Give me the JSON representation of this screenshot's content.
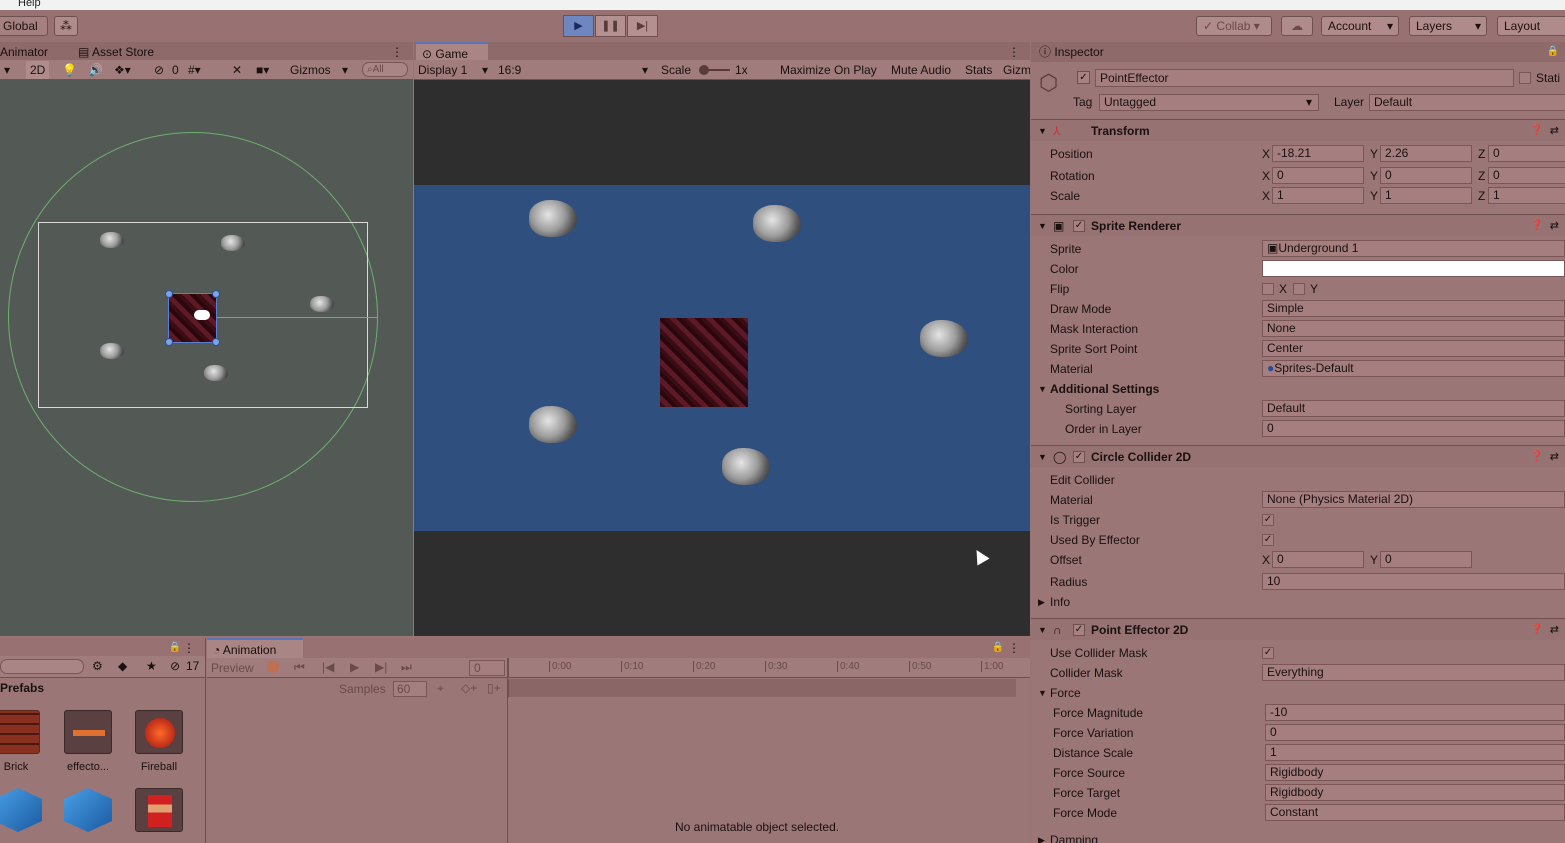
{
  "menu": {
    "item": "Help"
  },
  "toolbar": {
    "global": "Global",
    "collab": "Collab",
    "account": "Account",
    "layers": "Layers",
    "layout": "Layout",
    "play_icon": "play-icon",
    "pause_icon": "pause-icon",
    "step_icon": "step-icon"
  },
  "scene_tabs": {
    "animator": "Animator",
    "asset_store": "Asset Store"
  },
  "scene_toolbar": {
    "mode_2d": "2D",
    "hidden_count": "0",
    "gizmos": "Gizmos",
    "search_placeholder": "All"
  },
  "game": {
    "tab": "Game",
    "display": "Display 1",
    "aspect": "16:9",
    "scale_label": "Scale",
    "scale_value": "1x",
    "maximize": "Maximize On Play",
    "mute": "Mute Audio",
    "stats": "Stats",
    "gizmos": "Gizm",
    "background_color": "#2f4f7f"
  },
  "inspector": {
    "tab": "Inspector",
    "object_name": "PointEffector",
    "static": "Stati",
    "tag_label": "Tag",
    "tag_value": "Untagged",
    "layer_label": "Layer",
    "layer_value": "Default",
    "transform": {
      "title": "Transform",
      "position_label": "Position",
      "rotation_label": "Rotation",
      "scale_label": "Scale",
      "position": {
        "x": "-18.21",
        "y": "2.26",
        "z": "0"
      },
      "rotation": {
        "x": "0",
        "y": "0",
        "z": "0"
      },
      "scale": {
        "x": "1",
        "y": "1",
        "z": "1"
      },
      "axis_x": "X",
      "axis_y": "Y",
      "axis_z": "Z"
    },
    "sprite_renderer": {
      "title": "Sprite Renderer",
      "sprite_label": "Sprite",
      "sprite_value": "Underground 1",
      "color_label": "Color",
      "flip_label": "Flip",
      "flip_x": "X",
      "flip_y": "Y",
      "draw_mode_label": "Draw Mode",
      "draw_mode_value": "Simple",
      "mask_label": "Mask Interaction",
      "mask_value": "None",
      "sort_point_label": "Sprite Sort Point",
      "sort_point_value": "Center",
      "material_label": "Material",
      "material_value": "Sprites-Default",
      "additional": "Additional Settings",
      "sorting_layer_label": "Sorting Layer",
      "sorting_layer_value": "Default",
      "order_label": "Order in Layer",
      "order_value": "0"
    },
    "circle_collider": {
      "title": "Circle Collider 2D",
      "edit_collider": "Edit Collider",
      "material_label": "Material",
      "material_value": "None (Physics Material 2D)",
      "is_trigger_label": "Is Trigger",
      "used_by_effector_label": "Used By Effector",
      "offset_label": "Offset",
      "offset_x": "0",
      "offset_y": "0",
      "radius_label": "Radius",
      "radius_value": "10",
      "info": "Info"
    },
    "point_effector": {
      "title": "Point Effector 2D",
      "use_mask_label": "Use Collider Mask",
      "mask_label": "Collider Mask",
      "mask_value": "Everything",
      "force": "Force",
      "magnitude_label": "Force Magnitude",
      "magnitude_value": "-10",
      "variation_label": "Force Variation",
      "variation_value": "0",
      "distance_label": "Distance Scale",
      "distance_value": "1",
      "source_label": "Force Source",
      "source_value": "Rigidbody",
      "target_label": "Force Target",
      "target_value": "Rigidbody",
      "mode_label": "Force Mode",
      "mode_value": "Constant",
      "damping": "Damping"
    }
  },
  "project": {
    "hidden_count": "17",
    "folder": "Prefabs",
    "items": [
      {
        "label": "Brick"
      },
      {
        "label": "effecto..."
      },
      {
        "label": "Fireball"
      }
    ]
  },
  "animation": {
    "tab": "Animation",
    "preview": "Preview",
    "frame": "0",
    "samples_label": "Samples",
    "samples_value": "60",
    "message": "No animatable object selected.",
    "ticks": [
      "0:00",
      "0:10",
      "0:20",
      "0:30",
      "0:40",
      "0:50",
      "1:00"
    ]
  }
}
